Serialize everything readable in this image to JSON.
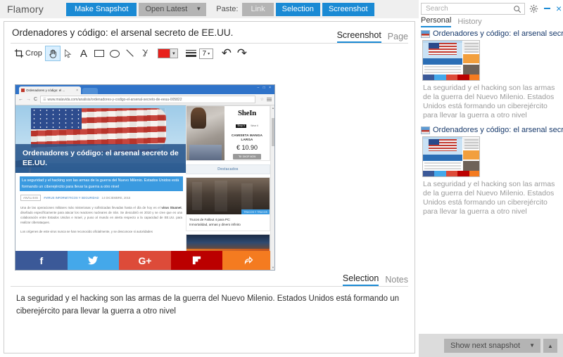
{
  "app": {
    "brand": "Flamory"
  },
  "toolbar": {
    "make_snapshot": "Make Snapshot",
    "open_latest": "Open Latest",
    "caret": "▼",
    "paste_label": "Paste:",
    "paste_link": "Link",
    "paste_selection": "Selection",
    "paste_screenshot": "Screenshot",
    "accent": "#1a8ad4",
    "disabled_bg": "#b4b4b4"
  },
  "search": {
    "value": "",
    "placeholder": "Search",
    "icon": "search-icon"
  },
  "window_controls": {
    "settings": "gear-icon",
    "minimize": "minimize-icon",
    "close": "×"
  },
  "sidebar": {
    "tabs": [
      {
        "label": "Personal",
        "active": true
      },
      {
        "label": "History",
        "active": false
      }
    ],
    "snapshots": [
      {
        "title": "Ordenadores y código: el arsenal secreto de EE",
        "description": "La seguridad y el hacking son las armas de la guerra del Nuevo Milenio. Estados Unidos está formando un ciberejército para llevar la guerra a otro nivel"
      },
      {
        "title": "Ordenadores y código: el arsenal secreto de EE",
        "description": "La seguridad y el hacking son las armas de la guerra del Nuevo Milenio. Estados Unidos está formando un ciberejército para llevar la guerra a otro nivel"
      }
    ]
  },
  "footer": {
    "show_next": "Show next snapshot",
    "caret_down": "▼",
    "caret_up": "▲"
  },
  "main": {
    "title": "Ordenadores y código: el arsenal secreto de EE.UU.",
    "tabs": [
      {
        "label": "Screenshot",
        "active": true
      },
      {
        "label": "Page",
        "active": false
      }
    ],
    "edit_tools": {
      "crop_label": "Crop",
      "crop_icon": "crop-icon",
      "hand_icon": "hand-tool-icon",
      "pointer_icon": "pointer-tool-icon",
      "text_icon": "A",
      "rect_icon": "rectangle-tool-icon",
      "ellipse_icon": "ellipse-tool-icon",
      "line_icon": "line-tool-icon",
      "scribble_icon": "scribble-tool-icon",
      "color_value": "#e8201c",
      "color_caret": "▾",
      "thickness_icon": "thickness-icon",
      "size_value": "7",
      "size_caret": "▾",
      "undo_icon": "↶",
      "redo_icon": "↷"
    },
    "selection_tabs": [
      {
        "label": "Selection",
        "active": true
      },
      {
        "label": "Notes",
        "active": false
      }
    ],
    "selection_text": "La seguridad y el hacking son las armas de la guerra del Nuevo Milenio. Estados Unidos está formando un ciberejército para llevar la guerra a otro nivel"
  },
  "screenshot": {
    "browser": {
      "tab_title": "Ordenadores y código: el ...",
      "tab_close": "×",
      "back_icon": "←",
      "forward_icon": "→",
      "reload_icon": "C",
      "page_icon": "☰",
      "url": "www.malavida.com/analisis/ordenadores-y-codigo-el-arsenal-secreto-de-eeuu-005822",
      "star_icon": "☆",
      "menu_icon": "menu-icon",
      "win_controls": "– □ ×"
    },
    "article": {
      "headline": "Ordenadores y código: el arsenal secreto de EE.UU.",
      "highlight": "La seguridad y el hacking son las armas de la guerra del Nuevo Milenio. Estados Unidos está formando un ciberejército para llevar la guerra a otro nivel",
      "tag_category": "ANÁLISIS",
      "tag_topic": "#VIRUS INFORMÁTICOS Y SEGURIDAD",
      "date": "14 DICIEMBRE, 2015",
      "paragraph1_a": "Una de las operaciones militares más misteriosas y sofisticadas llevadas hasta el día de hoy es el ",
      "paragraph1_b": "virus Stuxnet",
      "paragraph1_c": ", diseñado específicamente para atacar los reactores nucleares de Irán. Se descubrió en 2010 y se cree que es una colaboración entre Estados Unidos e Israel, y puso al mundo en alerta respecto a la capacidad de EE.UU. para realizar ciberataques.",
      "paragraph2": "Los orígenes de este virus nunca se han reconocido oficialmente, y se desconoce si autoridades"
    },
    "ad": {
      "brand": "SheIn",
      "brand_sub": "Shop It",
      "brand_sub2": "Wear it",
      "product": "CAMISETA MANGA LARGA",
      "price": "€ 10.90",
      "cta": "SHOP NOW",
      "cart_icon": "cart-icon"
    },
    "featured": {
      "header": "Destacados",
      "badge": "TRUCOS Y TRUCOS",
      "item1_line1": "Trucos de Fallout 4 para PC:",
      "item1_line2": "Inmortalidad, armas y dinero infinito"
    },
    "social": [
      {
        "name": "facebook-icon",
        "glyph": "f",
        "color": "#3b5998"
      },
      {
        "name": "twitter-icon",
        "glyph": "",
        "color": "#44a8ea"
      },
      {
        "name": "google-plus-icon",
        "glyph": "G+",
        "color": "#dd4b39"
      },
      {
        "name": "flipboard-icon",
        "glyph": "",
        "color": "#bb0000"
      },
      {
        "name": "share-icon",
        "glyph": "",
        "color": "#f47b20"
      }
    ]
  }
}
